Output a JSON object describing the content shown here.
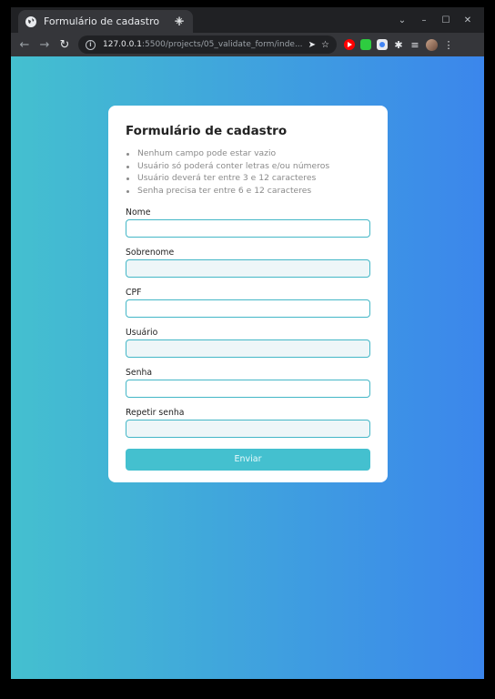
{
  "browser": {
    "tab_title": "Formulário de cadastro",
    "tab_close": "✕",
    "new_tab": "+",
    "controls": {
      "menu": "⌄",
      "minimize": "–",
      "maximize": "☐",
      "close": "✕"
    },
    "url_host": "127.0.0.1",
    "url_rest": ":5500/projects/05_validate_form/inde...",
    "nav": {
      "back": "←",
      "forward": "→",
      "reload": "↻"
    },
    "info": "i",
    "send": "➤",
    "star": "☆",
    "puzzle": "✱",
    "queue": "≡",
    "more": "⋮"
  },
  "form": {
    "title": "Formulário de cadastro",
    "rules": [
      "Nenhum campo pode estar vazio",
      "Usuário só poderá conter letras e/ou números",
      "Usuário deverá ter entre 3 e 12 caracteres",
      "Senha precisa ter entre 6 e 12 caracteres"
    ],
    "fields": [
      {
        "label": "Nome",
        "value": ""
      },
      {
        "label": "Sobrenome",
        "value": ""
      },
      {
        "label": "CPF",
        "value": ""
      },
      {
        "label": "Usuário",
        "value": ""
      },
      {
        "label": "Senha",
        "value": ""
      },
      {
        "label": "Repetir senha",
        "value": ""
      }
    ],
    "submit_label": "Enviar"
  },
  "colors": {
    "gradient_start": "#44c0cf",
    "gradient_end": "#3b86ec",
    "accent": "#44c0cf"
  }
}
